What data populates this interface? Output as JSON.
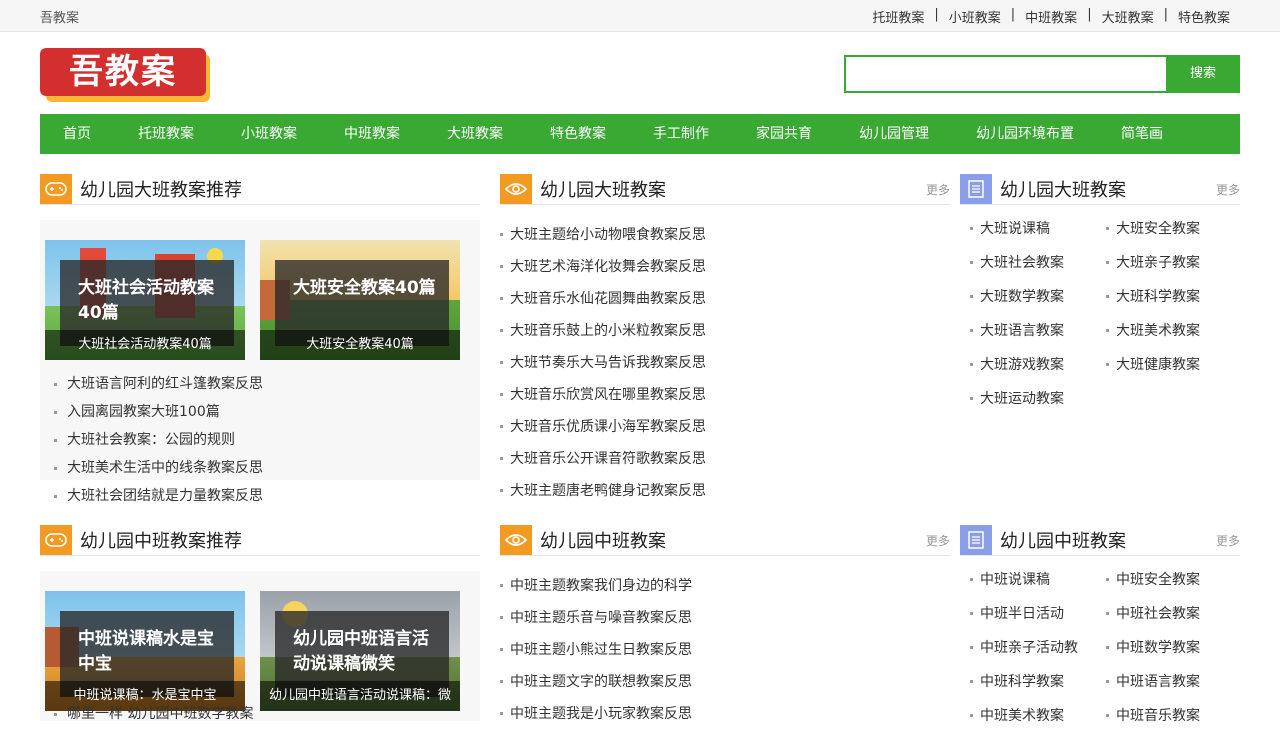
{
  "topbar": {
    "site": "吾教案",
    "links": [
      "托班教案",
      "小班教案",
      "中班教案",
      "大班教案",
      "特色教案"
    ]
  },
  "logo": {
    "text": "吾教案"
  },
  "search": {
    "placeholder": "",
    "button": "搜索"
  },
  "nav": [
    "首页",
    "托班教案",
    "小班教案",
    "中班教案",
    "大班教案",
    "特色教案",
    "手工制作",
    "家园共育",
    "幼儿园管理",
    "幼儿园环境布置",
    "简笔画"
  ],
  "sections": {
    "big_featured": {
      "title": "幼儿园大班教案推荐",
      "cards": [
        {
          "overlay": [
            "大班社会活动教案",
            "40篇"
          ],
          "caption": "大班社会活动教案40篇"
        },
        {
          "overlay": [
            "大班安全教案40篇"
          ],
          "caption": "大班安全教案40篇"
        }
      ],
      "items": [
        "大班语言阿利的红斗篷教案反思",
        "入园离园教案大班100篇",
        "大班社会教案：公园的规则",
        "大班美术生活中的线条教案反思",
        "大班社会团结就是力量教案反思"
      ]
    },
    "big_list": {
      "title": "幼儿园大班教案",
      "more": "更多",
      "items": [
        "大班主题给小动物喂食教案反思",
        "大班艺术海洋化妆舞会教案反思",
        "大班音乐水仙花圆舞曲教案反思",
        "大班音乐鼓上的小米粒教案反思",
        "大班节奏乐大马告诉我教案反思",
        "大班音乐欣赏风在哪里教案反思",
        "大班音乐优质课小海军教案反思",
        "大班音乐公开课音符歌教案反思",
        "大班主题唐老鸭健身记教案反思"
      ]
    },
    "big_cats": {
      "title": "幼儿园大班教案",
      "more": "更多",
      "items": [
        "大班说课稿",
        "大班安全教案",
        "大班社会教案",
        "大班亲子教案",
        "大班数学教案",
        "大班科学教案",
        "大班语言教案",
        "大班美术教案",
        "大班游戏教案",
        "大班健康教案",
        "大班运动教案"
      ]
    },
    "mid_featured": {
      "title": "幼儿园中班教案推荐",
      "cards": [
        {
          "overlay": [
            "中班说课稿水是宝",
            "中宝"
          ],
          "caption": "中班说课稿：水是宝中宝"
        },
        {
          "overlay": [
            "幼儿园中班语言活",
            "动说课稿微笑"
          ],
          "caption": "幼儿园中班语言活动说课稿：微"
        }
      ],
      "items": [
        "哪里一样 幼儿园中班数学教案"
      ]
    },
    "mid_list": {
      "title": "幼儿园中班教案",
      "more": "更多",
      "items": [
        "中班主题教案我们身边的科学",
        "中班主题乐音与噪音教案反思",
        "中班主题小熊过生日教案反思",
        "中班主题文字的联想教案反思",
        "中班主题我是小玩家教案反思"
      ]
    },
    "mid_cats": {
      "title": "幼儿园中班教案",
      "more": "更多",
      "items": [
        "中班说课稿",
        "中班安全教案",
        "中班半日活动",
        "中班社会教案",
        "中班亲子活动教",
        "中班数学教案",
        "中班科学教案",
        "中班语言教案",
        "中班美术教案",
        "中班音乐教案"
      ]
    }
  },
  "colors": {
    "green": "#3aa933",
    "orange": "#f39a22",
    "icon_blue": "#8a9de8",
    "logo_red": "#d32f2f"
  }
}
